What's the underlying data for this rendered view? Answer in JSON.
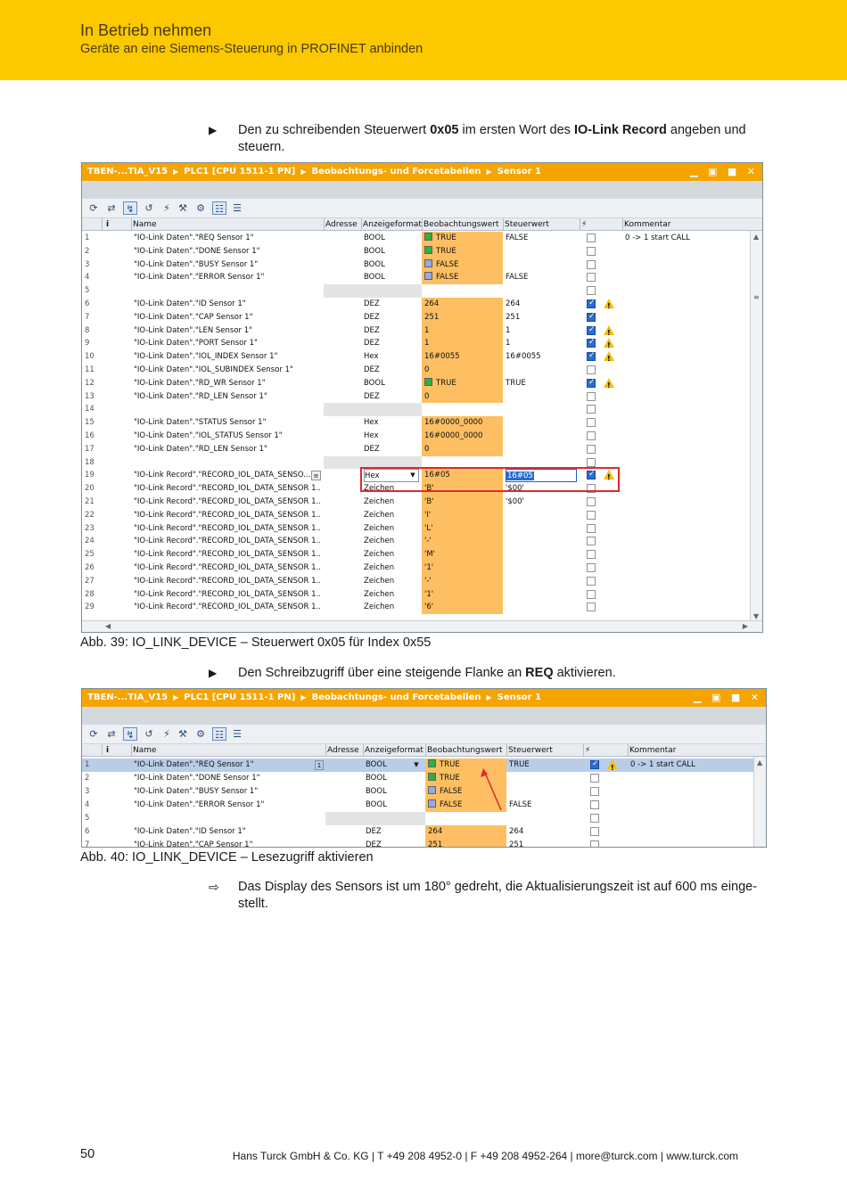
{
  "header": {
    "title": "In Betrieb nehmen",
    "subtitle": "Geräte an eine Siemens-Steuerung in PROFINET anbinden"
  },
  "step1": {
    "marker": "▶",
    "pre": "Den zu schreibenden Steuerwert ",
    "bold1": "0x05",
    "mid": " im ersten Wort des ",
    "bold2": "IO-Link Record",
    "post": " angeben und steuern."
  },
  "figure1": {
    "breadcrumb": [
      "TBEN-...TIA_V15",
      "PLC1 [CPU 1511-1 PN]",
      "Beobachtungs- und Forcetabellen",
      "Sensor 1"
    ],
    "columns": [
      "",
      "i",
      "Name",
      "Adresse",
      "Anzeigeformat",
      "Beobachtungswert",
      "Steuerwert",
      "⚡",
      "Kommentar"
    ],
    "rows": [
      {
        "n": "1",
        "name": "\"IO-Link Daten\".\"REQ Sensor 1\"",
        "fmt": "BOOL",
        "obs": "TRUE",
        "sq": "green",
        "ctrl": "FALSE",
        "chk": false,
        "warn": false,
        "comment": "0 -> 1 start CALL"
      },
      {
        "n": "2",
        "name": "\"IO-Link Daten\".\"DONE Sensor 1\"",
        "fmt": "BOOL",
        "obs": "TRUE",
        "sq": "green",
        "ctrl": "",
        "chk": false,
        "warn": false,
        "comment": ""
      },
      {
        "n": "3",
        "name": "\"IO-Link Daten\".\"BUSY Sensor 1\"",
        "fmt": "BOOL",
        "obs": "FALSE",
        "sq": "blue",
        "ctrl": "",
        "chk": false,
        "warn": false,
        "comment": ""
      },
      {
        "n": "4",
        "name": "\"IO-Link Daten\".\"ERROR Sensor 1\"",
        "fmt": "BOOL",
        "obs": "FALSE",
        "sq": "blue",
        "ctrl": "FALSE",
        "chk": false,
        "warn": false,
        "comment": ""
      },
      {
        "n": "5",
        "name": "",
        "fmt": "",
        "obs": "",
        "sq": "",
        "ctrl": "",
        "chk": false,
        "warn": false,
        "comment": "",
        "empty": true
      },
      {
        "n": "6",
        "name": "\"IO-Link Daten\".\"ID Sensor 1\"",
        "fmt": "DEZ",
        "obs": "264",
        "sq": "",
        "ctrl": "264",
        "chk": true,
        "warn": true,
        "comment": ""
      },
      {
        "n": "7",
        "name": "\"IO-Link Daten\".\"CAP Sensor 1\"",
        "fmt": "DEZ",
        "obs": "251",
        "sq": "",
        "ctrl": "251",
        "chk": true,
        "warn": false,
        "comment": ""
      },
      {
        "n": "8",
        "name": "\"IO-Link Daten\".\"LEN Sensor 1\"",
        "fmt": "DEZ",
        "obs": "1",
        "sq": "",
        "ctrl": "1",
        "chk": true,
        "warn": true,
        "comment": ""
      },
      {
        "n": "9",
        "name": "\"IO-Link Daten\".\"PORT Sensor 1\"",
        "fmt": "DEZ",
        "obs": "1",
        "sq": "",
        "ctrl": "1",
        "chk": true,
        "warn": true,
        "comment": ""
      },
      {
        "n": "10",
        "name": "\"IO-Link Daten\".\"IOL_INDEX Sensor 1\"",
        "fmt": "Hex",
        "obs": "16#0055",
        "sq": "",
        "ctrl": "16#0055",
        "chk": true,
        "warn": true,
        "comment": ""
      },
      {
        "n": "11",
        "name": "\"IO-Link Daten\".\"IOL_SUBINDEX Sensor 1\"",
        "fmt": "DEZ",
        "obs": "0",
        "sq": "",
        "ctrl": "",
        "chk": false,
        "warn": false,
        "comment": ""
      },
      {
        "n": "12",
        "name": "\"IO-Link Daten\".\"RD_WR Sensor 1\"",
        "fmt": "BOOL",
        "obs": "TRUE",
        "sq": "green",
        "ctrl": "TRUE",
        "chk": true,
        "warn": true,
        "comment": ""
      },
      {
        "n": "13",
        "name": "\"IO-Link Daten\".\"RD_LEN Sensor 1\"",
        "fmt": "DEZ",
        "obs": "0",
        "sq": "",
        "ctrl": "",
        "chk": false,
        "warn": false,
        "comment": ""
      },
      {
        "n": "14",
        "name": "",
        "fmt": "",
        "obs": "",
        "sq": "",
        "ctrl": "",
        "chk": false,
        "warn": false,
        "comment": "",
        "empty": true
      },
      {
        "n": "15",
        "name": "\"IO-Link Daten\".\"STATUS Sensor 1\"",
        "fmt": "Hex",
        "obs": "16#0000_0000",
        "sq": "",
        "ctrl": "",
        "chk": false,
        "warn": false,
        "comment": ""
      },
      {
        "n": "16",
        "name": "\"IO-Link Daten\".\"IOL_STATUS Sensor 1\"",
        "fmt": "Hex",
        "obs": "16#0000_0000",
        "sq": "",
        "ctrl": "",
        "chk": false,
        "warn": false,
        "comment": ""
      },
      {
        "n": "17",
        "name": "\"IO-Link Daten\".\"RD_LEN Sensor 1\"",
        "fmt": "DEZ",
        "obs": "0",
        "sq": "",
        "ctrl": "",
        "chk": false,
        "warn": false,
        "comment": ""
      },
      {
        "n": "18",
        "name": "",
        "fmt": "",
        "obs": "",
        "sq": "",
        "ctrl": "",
        "chk": false,
        "warn": false,
        "comment": "",
        "empty": true
      },
      {
        "n": "19",
        "name": "\"IO-Link Record\".\"RECORD_IOL_DATA_SENSO...",
        "fmt": "Hex",
        "obs": "16#05",
        "sq": "",
        "ctrl": "16#05",
        "chk": true,
        "warn": true,
        "comment": "",
        "edit": true
      },
      {
        "n": "20",
        "name": "\"IO-Link Record\".\"RECORD_IOL_DATA_SENSOR 1...",
        "fmt": "Zeichen",
        "obs": "'B'",
        "sq": "",
        "ctrl": "'$00'",
        "chk": false,
        "warn": false,
        "comment": ""
      },
      {
        "n": "21",
        "name": "\"IO-Link Record\".\"RECORD_IOL_DATA_SENSOR 1...",
        "fmt": "Zeichen",
        "obs": "'B'",
        "sq": "",
        "ctrl": "'$00'",
        "chk": false,
        "warn": false,
        "comment": ""
      },
      {
        "n": "22",
        "name": "\"IO-Link Record\".\"RECORD_IOL_DATA_SENSOR 1...",
        "fmt": "Zeichen",
        "obs": "'I'",
        "sq": "",
        "ctrl": "",
        "chk": false,
        "warn": false,
        "comment": ""
      },
      {
        "n": "23",
        "name": "\"IO-Link Record\".\"RECORD_IOL_DATA_SENSOR 1...",
        "fmt": "Zeichen",
        "obs": "'L'",
        "sq": "",
        "ctrl": "",
        "chk": false,
        "warn": false,
        "comment": ""
      },
      {
        "n": "24",
        "name": "\"IO-Link Record\".\"RECORD_IOL_DATA_SENSOR 1...",
        "fmt": "Zeichen",
        "obs": "'-'",
        "sq": "",
        "ctrl": "",
        "chk": false,
        "warn": false,
        "comment": ""
      },
      {
        "n": "25",
        "name": "\"IO-Link Record\".\"RECORD_IOL_DATA_SENSOR 1...",
        "fmt": "Zeichen",
        "obs": "'M'",
        "sq": "",
        "ctrl": "",
        "chk": false,
        "warn": false,
        "comment": ""
      },
      {
        "n": "26",
        "name": "\"IO-Link Record\".\"RECORD_IOL_DATA_SENSOR 1...",
        "fmt": "Zeichen",
        "obs": "'1'",
        "sq": "",
        "ctrl": "",
        "chk": false,
        "warn": false,
        "comment": ""
      },
      {
        "n": "27",
        "name": "\"IO-Link Record\".\"RECORD_IOL_DATA_SENSOR 1...",
        "fmt": "Zeichen",
        "obs": "'-'",
        "sq": "",
        "ctrl": "",
        "chk": false,
        "warn": false,
        "comment": ""
      },
      {
        "n": "28",
        "name": "\"IO-Link Record\".\"RECORD_IOL_DATA_SENSOR 1...",
        "fmt": "Zeichen",
        "obs": "'1'",
        "sq": "",
        "ctrl": "",
        "chk": false,
        "warn": false,
        "comment": ""
      },
      {
        "n": "29",
        "name": "\"IO-Link Record\".\"RECORD_IOL_DATA_SENSOR 1...",
        "fmt": "Zeichen",
        "obs": "'6'",
        "sq": "",
        "ctrl": "",
        "chk": false,
        "warn": false,
        "comment": ""
      }
    ],
    "caption": "Abb. 39: IO_LINK_DEVICE – Steuerwert 0x05 für Index 0x55"
  },
  "step2": {
    "marker": "▶",
    "pre": "Den Schreibzugriff über eine steigende Flanke an ",
    "bold1": "REQ",
    "post": " aktivieren."
  },
  "figure2": {
    "breadcrumb": [
      "TBEN-...TIA_V15",
      "PLC1 [CPU 1511-1 PN]",
      "Beobachtungs- und Forcetabellen",
      "Sensor 1"
    ],
    "columns": [
      "",
      "i",
      "Name",
      "Adresse",
      "Anzeigeformat",
      "Beobachtungswert",
      "Steuerwert",
      "⚡",
      "Kommentar"
    ],
    "rows": [
      {
        "n": "1",
        "name": "\"IO-Link Daten\".\"REQ Sensor 1\"",
        "fmt": "BOOL",
        "obs": "TRUE",
        "sq": "green",
        "ctrl": "TRUE",
        "chk": true,
        "warn": true,
        "comment": "0 -> 1 start CALL",
        "selected": true
      },
      {
        "n": "2",
        "name": "\"IO-Link Daten\".\"DONE Sensor 1\"",
        "fmt": "BOOL",
        "obs": "TRUE",
        "sq": "green",
        "ctrl": "",
        "chk": false,
        "warn": false,
        "comment": ""
      },
      {
        "n": "3",
        "name": "\"IO-Link Daten\".\"BUSY Sensor 1\"",
        "fmt": "BOOL",
        "obs": "FALSE",
        "sq": "blue",
        "ctrl": "",
        "chk": false,
        "warn": false,
        "comment": ""
      },
      {
        "n": "4",
        "name": "\"IO-Link Daten\".\"ERROR Sensor 1\"",
        "fmt": "BOOL",
        "obs": "FALSE",
        "sq": "blue",
        "ctrl": "FALSE",
        "chk": false,
        "warn": false,
        "comment": ""
      },
      {
        "n": "5",
        "name": "",
        "fmt": "",
        "obs": "",
        "sq": "",
        "ctrl": "",
        "chk": false,
        "warn": false,
        "comment": "",
        "empty": true
      },
      {
        "n": "6",
        "name": "\"IO-Link Daten\".\"ID Sensor 1\"",
        "fmt": "DEZ",
        "obs": "264",
        "sq": "",
        "ctrl": "264",
        "chk": false,
        "warn": false,
        "comment": ""
      },
      {
        "n": "7",
        "name": "\"IO-Link Daten\".\"CAP Sensor 1\"",
        "fmt": "DEZ",
        "obs": "251",
        "sq": "",
        "ctrl": "251",
        "chk": false,
        "warn": false,
        "comment": ""
      }
    ],
    "caption": "Abb. 40: IO_LINK_DEVICE – Lesezugriff aktivieren"
  },
  "result": {
    "marker": "⇨",
    "text": "Das Display des Sensors ist um 180° gedreht, die Aktualisierungszeit ist auf 600 ms einge-stellt."
  },
  "footer": {
    "page": "50",
    "info": "Hans Turck GmbH & Co. KG | T +49 208 4952-0 | F +49 208 4952-264 | more@turck.com | www.turck.com"
  },
  "colors": {
    "brand": "#fcc800",
    "tia_titlebar": "#f6a400",
    "observed_cell": "#fdbf62",
    "highlight_box": "#e0282e",
    "annotation_arrow": "#e0282e"
  }
}
